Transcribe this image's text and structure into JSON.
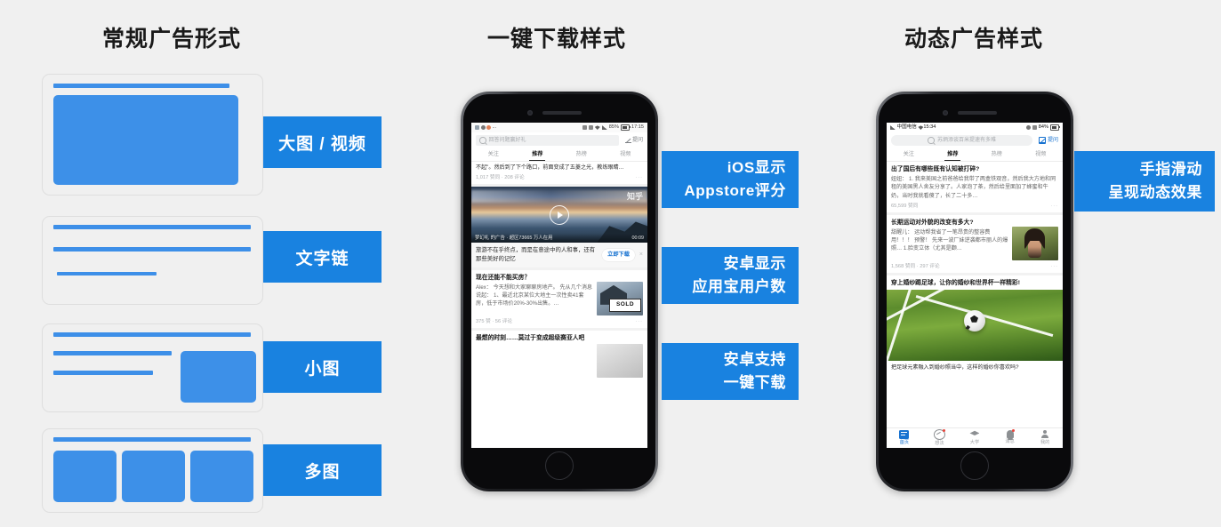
{
  "headings": {
    "left": "常规广告形式",
    "middle": "一键下载样式",
    "right": "动态广告样式"
  },
  "colors": {
    "accent_blue": "#1982e0",
    "fill_blue": "#3d90e8",
    "background": "#f0f0f0",
    "card_border": "#dedede"
  },
  "left_column": {
    "chips": [
      {
        "label": "大图 / 视频"
      },
      {
        "label": "文字链"
      },
      {
        "label": "小图"
      },
      {
        "label": "多图"
      }
    ]
  },
  "middle_column": {
    "callouts": [
      {
        "line1": "iOS显示",
        "line2": "Appstore评分"
      },
      {
        "line1": "安卓显示",
        "line2": "应用宝用户数"
      },
      {
        "line1": "安卓支持",
        "line2": "一键下载"
      }
    ],
    "phone": {
      "status_bar": {
        "battery": "85%",
        "time": "17:15",
        "left_dots": "..."
      },
      "search": {
        "placeholder": "回答问题赢好礼",
        "ask_label": "提问"
      },
      "tabs": [
        {
          "label": "关注",
          "active": false
        },
        {
          "label": "推荐",
          "active": true
        },
        {
          "label": "热榜",
          "active": false
        },
        {
          "label": "视频",
          "active": false
        }
      ],
      "feed": {
        "truncated_post": {
          "body": "不起\"。然后到了下个路口，前面变成了五菱之光，教练眼睛…",
          "meta": "1,017 赞同 · 208 评论"
        },
        "video_ad": {
          "watermark": "知乎",
          "byline": "梦幻礼 的广告 · 超区73665 万人在用",
          "duration": "00:09",
          "caption": "旅游不在乎终点，而是在意途中的人和事，还有那些美好的记忆",
          "download_button": "立即下载",
          "close_icon": "×"
        },
        "house_post": {
          "title": "现在还能不能买房？",
          "body": "Alex： 今天想和大家聊聊房地产。 先从几个消息说起： 1、最近北京某位大地主一次性卖41套房，低于市场价20%-30%出售。…",
          "meta": "375 赞 · 56 评论",
          "thumb_text": "SOLD"
        },
        "bottom_post": {
          "title": "最燃的时刻……莫过于变成超级赛亚人吧"
        }
      }
    }
  },
  "right_column": {
    "callouts": [
      {
        "line1": "手指滑动",
        "line2": "呈现动态效果"
      }
    ],
    "phone": {
      "status_bar": {
        "carrier": "中国电信",
        "time": "15:34",
        "battery": "84%"
      },
      "search": {
        "placeholder": "苏炳添谈百米提速有多难",
        "ask_label": "提问"
      },
      "tabs": [
        {
          "label": "关注",
          "active": false
        },
        {
          "label": "推荐",
          "active": true
        },
        {
          "label": "热榜",
          "active": false
        },
        {
          "label": "视频",
          "active": false
        }
      ],
      "feed": {
        "post1": {
          "title": "出了国后有哪些既有认知被打碎?",
          "body": "妞妞： 1. 我来美国之前爸爸给我带了两盒铁观音，然后我大方地和同租的美国黑人舍友分享了。人家泡了茶，然后给里面加了蜂蜜和牛奶，当时我就看傻了，长了二十多…",
          "meta": "65,599 赞同"
        },
        "post2": {
          "title": "长期运动对外貌的改变有多大?",
          "body": "甜醒儿： 运动帮我省了一笔昂贵的整容费用！！！ 预警！ 先来一波厂妹逆袭都市丽人的爆照… 1.脸变立体（尤其是颧…",
          "meta": "1,568 赞同 · 297 评论"
        },
        "post3": {
          "title": "穿上婚纱踢足球，让你的婚纱和世界杯一样精彩!",
          "caption": "把足球元素融入到婚纱照当中，这样的婚纱你喜欢吗?"
        }
      },
      "nav": [
        {
          "label": "首页",
          "icon": "home-icon",
          "active": true
        },
        {
          "label": "想法",
          "icon": "idea-icon",
          "active": false
        },
        {
          "label": "大学",
          "icon": "university-icon",
          "active": false
        },
        {
          "label": "消息",
          "icon": "bell-icon",
          "active": false
        },
        {
          "label": "我的",
          "icon": "profile-icon",
          "active": false
        }
      ]
    }
  }
}
